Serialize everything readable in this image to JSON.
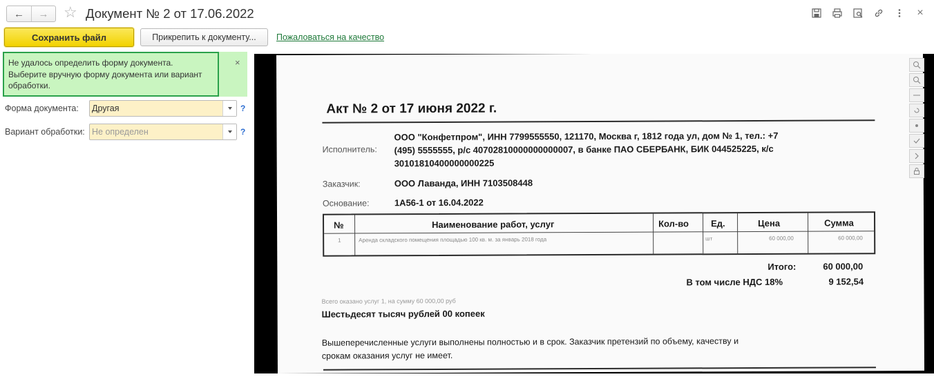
{
  "window": {
    "title": "Документ № 2 от 17.06.2022",
    "nav_back": "←",
    "nav_forward": "→",
    "favorite": "☆",
    "close": "×"
  },
  "toolbar": {
    "save_label": "Сохранить файл",
    "attach_label": "Прикрепить к документу...",
    "complain_label": "Пожаловаться на качество"
  },
  "message": {
    "lines": [
      "Не удалось определить форму документа.",
      "Выберите вручную форму документа или вариант",
      "обработки."
    ],
    "close": "×"
  },
  "form": {
    "doc_form_label": "Форма документа:",
    "doc_form_value": "Другая",
    "processing_label": "Вариант обработки:",
    "processing_value": "Не определен",
    "help": "?"
  },
  "preview": {
    "title": "Акт № 2 от 17 июня 2022 г.",
    "executor_label": "Исполнитель:",
    "executor_lines": [
      "ООО \"Конфетпром\", ИНН 7799555550, 121170, Москва г, 1812 года ул, дом № 1, тел.: +7",
      "(495) 5555555, р/с 40702810000000000007, в банке ПАО СБЕРБАНК, БИК 044525225, к/с",
      "30101810400000000225"
    ],
    "customer_label": "Заказчик:",
    "customer": "ООО Лаванда, ИНН 7103508448",
    "basis_label": "Основание:",
    "basis": "1А56-1 от 16.04.2022",
    "table": {
      "headers": [
        "№",
        "Наименование работ, услуг",
        "Кол-во",
        "Ед.",
        "Цена",
        "Сумма"
      ],
      "row": [
        "1",
        "Аренда складского помещения площадью 100 кв. м. за январь 2018 года",
        "",
        "шт",
        "60 000,00",
        "60 000,00"
      ]
    },
    "total_label": "Итого:",
    "total": "60 000,00",
    "vat_label": "В том числе НДС 18%",
    "vat": "9 152,54",
    "summary_small": "Всего оказано услуг 1, на сумму 60 000,00 руб",
    "amount_words": "Шестьдесят тысяч рублей 00 копеек",
    "note_lines": [
      "Вышеперечисленные услуги выполнены полностью и в срок. Заказчик претензий по объему, качеству и",
      "срокам оказания услуг не имеет."
    ]
  }
}
